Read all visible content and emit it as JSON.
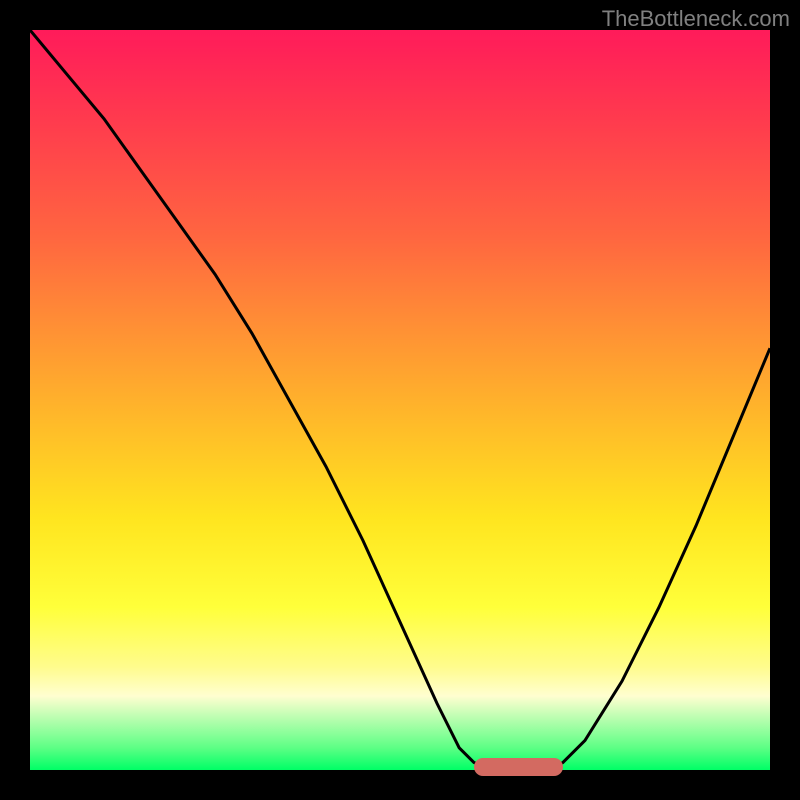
{
  "watermark": "TheBottleneck.com",
  "colors": {
    "bg": "#000000",
    "watermark": "#808080",
    "curve": "#000000",
    "flat_marker": "#d36a61"
  },
  "chart_data": {
    "type": "line",
    "title": "",
    "xlabel": "",
    "ylabel": "",
    "xlim": [
      0,
      100
    ],
    "ylim": [
      0,
      100
    ],
    "grid": false,
    "series": [
      {
        "name": "bottleneck-curve",
        "x": [
          0,
          5,
          10,
          15,
          20,
          25,
          30,
          35,
          40,
          45,
          50,
          55,
          58,
          60,
          63,
          66,
          70,
          72,
          75,
          80,
          85,
          90,
          95,
          100
        ],
        "values": [
          100,
          94,
          88,
          81,
          74,
          67,
          59,
          50,
          41,
          31,
          20,
          9,
          3,
          1,
          0,
          0,
          0,
          1,
          4,
          12,
          22,
          33,
          45,
          57
        ]
      }
    ],
    "annotations": [
      {
        "name": "optimal-flat-region",
        "x_start": 60,
        "x_end": 72,
        "y": 0
      }
    ],
    "background_gradient_stops": [
      {
        "pos": 0,
        "color": "#ff1b5a"
      },
      {
        "pos": 12,
        "color": "#ff3a4e"
      },
      {
        "pos": 28,
        "color": "#ff6640"
      },
      {
        "pos": 40,
        "color": "#ff8f35"
      },
      {
        "pos": 52,
        "color": "#ffb72a"
      },
      {
        "pos": 66,
        "color": "#ffe51f"
      },
      {
        "pos": 78,
        "color": "#ffff3a"
      },
      {
        "pos": 86,
        "color": "#fffc8c"
      },
      {
        "pos": 90,
        "color": "#fffed0"
      },
      {
        "pos": 97,
        "color": "#5dff85"
      },
      {
        "pos": 100,
        "color": "#00ff66"
      }
    ]
  }
}
